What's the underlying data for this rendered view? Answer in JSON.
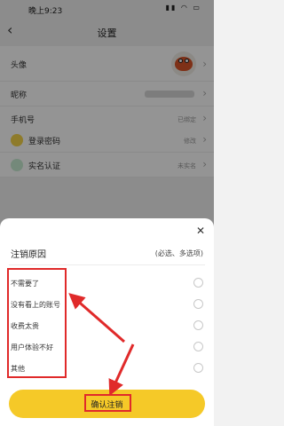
{
  "status_bar": {
    "time": "晚上9:23",
    "icons": "▮▮ ◠ ▭"
  },
  "nav": {
    "back_glyph": "‹",
    "title": "设置"
  },
  "settings": {
    "avatar_label": "头像",
    "nickname_label": "昵称",
    "phone_label": "手机号",
    "phone_value": "已绑定",
    "password_label": "登录密码",
    "password_value": "修改",
    "realname_label": "实名认证",
    "realname_value": "未实名",
    "chevron": "›"
  },
  "sheet": {
    "close_glyph": "✕",
    "title": "注销原因",
    "hint": "(必选、多选项)",
    "reasons": [
      {
        "label": "不需要了",
        "checked": false
      },
      {
        "label": "没有看上的账号",
        "checked": false
      },
      {
        "label": "收费太贵",
        "checked": false
      },
      {
        "label": "用户体验不好",
        "checked": false
      },
      {
        "label": "其他",
        "checked": false
      }
    ],
    "confirm_label": "确认注销"
  },
  "colors": {
    "accent": "#f5c928",
    "annotation": "#e02a2a"
  }
}
